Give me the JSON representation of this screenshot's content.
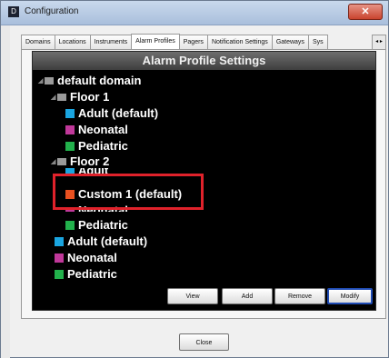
{
  "window": {
    "title": "Configuration",
    "app_icon_glyph": "D",
    "close_glyph": "✕"
  },
  "tabs": [
    {
      "label": "Domains",
      "active": false
    },
    {
      "label": "Locations",
      "active": false
    },
    {
      "label": "Instruments",
      "active": false
    },
    {
      "label": "Alarm Profiles",
      "active": true
    },
    {
      "label": "Pagers",
      "active": false
    },
    {
      "label": "Notification Settings",
      "active": false
    },
    {
      "label": "Gateways",
      "active": false
    },
    {
      "label": "Sys",
      "active": false
    }
  ],
  "tab_scroll": "◂ ▸",
  "panel": {
    "header": "Alarm Profile Settings",
    "tree": [
      {
        "label": "default domain",
        "kind": "folder"
      },
      {
        "label": "Floor 1",
        "kind": "folder"
      },
      {
        "label": "Adult (default)",
        "kind": "profile",
        "color": "#1aa5e0"
      },
      {
        "label": "Neonatal",
        "kind": "profile",
        "color": "#c0389a"
      },
      {
        "label": "Pediatric",
        "kind": "profile",
        "color": "#22b14c"
      },
      {
        "label": "Floor 2",
        "kind": "folder"
      },
      {
        "label": "Adult",
        "kind": "profile",
        "color": "#1aa5e0"
      },
      {
        "label": "Custom 1 (default)",
        "kind": "profile",
        "color": "#e8501f",
        "selected": true
      },
      {
        "label": "Neonatal",
        "kind": "profile",
        "color": "#c0389a"
      },
      {
        "label": "Pediatric",
        "kind": "profile",
        "color": "#22b14c"
      },
      {
        "label": "Adult (default)",
        "kind": "profile",
        "color": "#1aa5e0"
      },
      {
        "label": "Neonatal",
        "kind": "profile",
        "color": "#c0389a"
      },
      {
        "label": "Pediatric",
        "kind": "profile",
        "color": "#22b14c"
      }
    ],
    "buttons": {
      "view": "View",
      "add": "Add",
      "remove": "Remove",
      "modify": "Modify"
    }
  },
  "footer": {
    "close": "Close"
  },
  "colors": {
    "selection_highlight": "#e0222b",
    "panel_bg": "#000000",
    "header_bg": "#555555"
  }
}
